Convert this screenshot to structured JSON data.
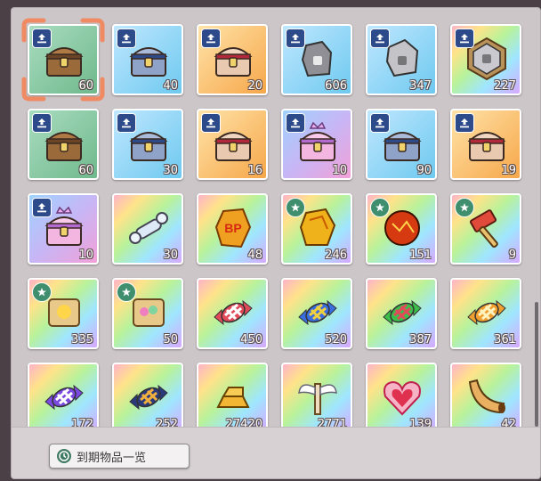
{
  "colors": {
    "green": "#6fb98c",
    "blue": "#6ec9ef",
    "orange": "#f6a74a",
    "purple": "#c7b6f5",
    "rainbow": "#ffe38a",
    "selection": "#f08a62"
  },
  "items": [
    {
      "qty": "60",
      "bg": "green",
      "badge": "upload",
      "icon": "chest-brown"
    },
    {
      "qty": "40",
      "bg": "blue",
      "badge": "upload",
      "icon": "chest-blue"
    },
    {
      "qty": "20",
      "bg": "orange",
      "badge": "upload",
      "icon": "chest-red"
    },
    {
      "qty": "606",
      "bg": "blue",
      "badge": "upload",
      "icon": "ore-gray"
    },
    {
      "qty": "347",
      "bg": "blue",
      "badge": "upload",
      "icon": "ore-silver"
    },
    {
      "qty": "227",
      "bg": "rainbow",
      "badge": "upload",
      "icon": "ore-framed"
    },
    {
      "qty": "60",
      "bg": "green",
      "badge": "upload",
      "icon": "chest-brown"
    },
    {
      "qty": "30",
      "bg": "blue",
      "badge": "upload",
      "icon": "chest-blue"
    },
    {
      "qty": "16",
      "bg": "orange",
      "badge": "upload",
      "icon": "chest-red"
    },
    {
      "qty": "10",
      "bg": "purple",
      "badge": "upload",
      "icon": "chest-pink-crown"
    },
    {
      "qty": "90",
      "bg": "blue",
      "badge": "upload",
      "icon": "chest-blue"
    },
    {
      "qty": "19",
      "bg": "orange",
      "badge": "upload",
      "icon": "chest-red"
    },
    {
      "qty": "10",
      "bg": "purple",
      "badge": "upload",
      "icon": "chest-pink-crown"
    },
    {
      "qty": "30",
      "bg": "rainbow",
      "badge": "",
      "icon": "bone"
    },
    {
      "qty": "48",
      "bg": "rainbow",
      "badge": "",
      "icon": "bp-crystal",
      "icon_text": "BP"
    },
    {
      "qty": "246",
      "bg": "rainbow",
      "badge": "star",
      "icon": "amber-stone"
    },
    {
      "qty": "151",
      "bg": "rainbow",
      "badge": "star",
      "icon": "lava-orb"
    },
    {
      "qty": "9",
      "bg": "rainbow",
      "badge": "star",
      "icon": "hammer"
    },
    {
      "qty": "335",
      "bg": "rainbow",
      "badge": "star",
      "icon": "scroll-gold"
    },
    {
      "qty": "50",
      "bg": "rainbow",
      "badge": "star",
      "icon": "scroll-gems"
    },
    {
      "qty": "450",
      "bg": "rainbow",
      "badge": "",
      "icon": "candy-red"
    },
    {
      "qty": "520",
      "bg": "rainbow",
      "badge": "",
      "icon": "candy-blue"
    },
    {
      "qty": "387",
      "bg": "rainbow",
      "badge": "",
      "icon": "candy-green"
    },
    {
      "qty": "361",
      "bg": "rainbow",
      "badge": "",
      "icon": "candy-orange"
    },
    {
      "qty": "172",
      "bg": "rainbow",
      "badge": "",
      "icon": "candy-purple"
    },
    {
      "qty": "252",
      "bg": "rainbow",
      "badge": "",
      "icon": "candy-navy"
    },
    {
      "qty": "27420",
      "bg": "rainbow",
      "badge": "",
      "icon": "gold-bars"
    },
    {
      "qty": "2771",
      "bg": "rainbow",
      "badge": "",
      "icon": "winged-scroll"
    },
    {
      "qty": "139",
      "bg": "rainbow",
      "badge": "",
      "icon": "heart-jewel"
    },
    {
      "qty": "42",
      "bg": "rainbow",
      "badge": "",
      "icon": "horn"
    }
  ],
  "selected_index": 0,
  "bottom": {
    "expire_button_label": "到期物品一览"
  }
}
